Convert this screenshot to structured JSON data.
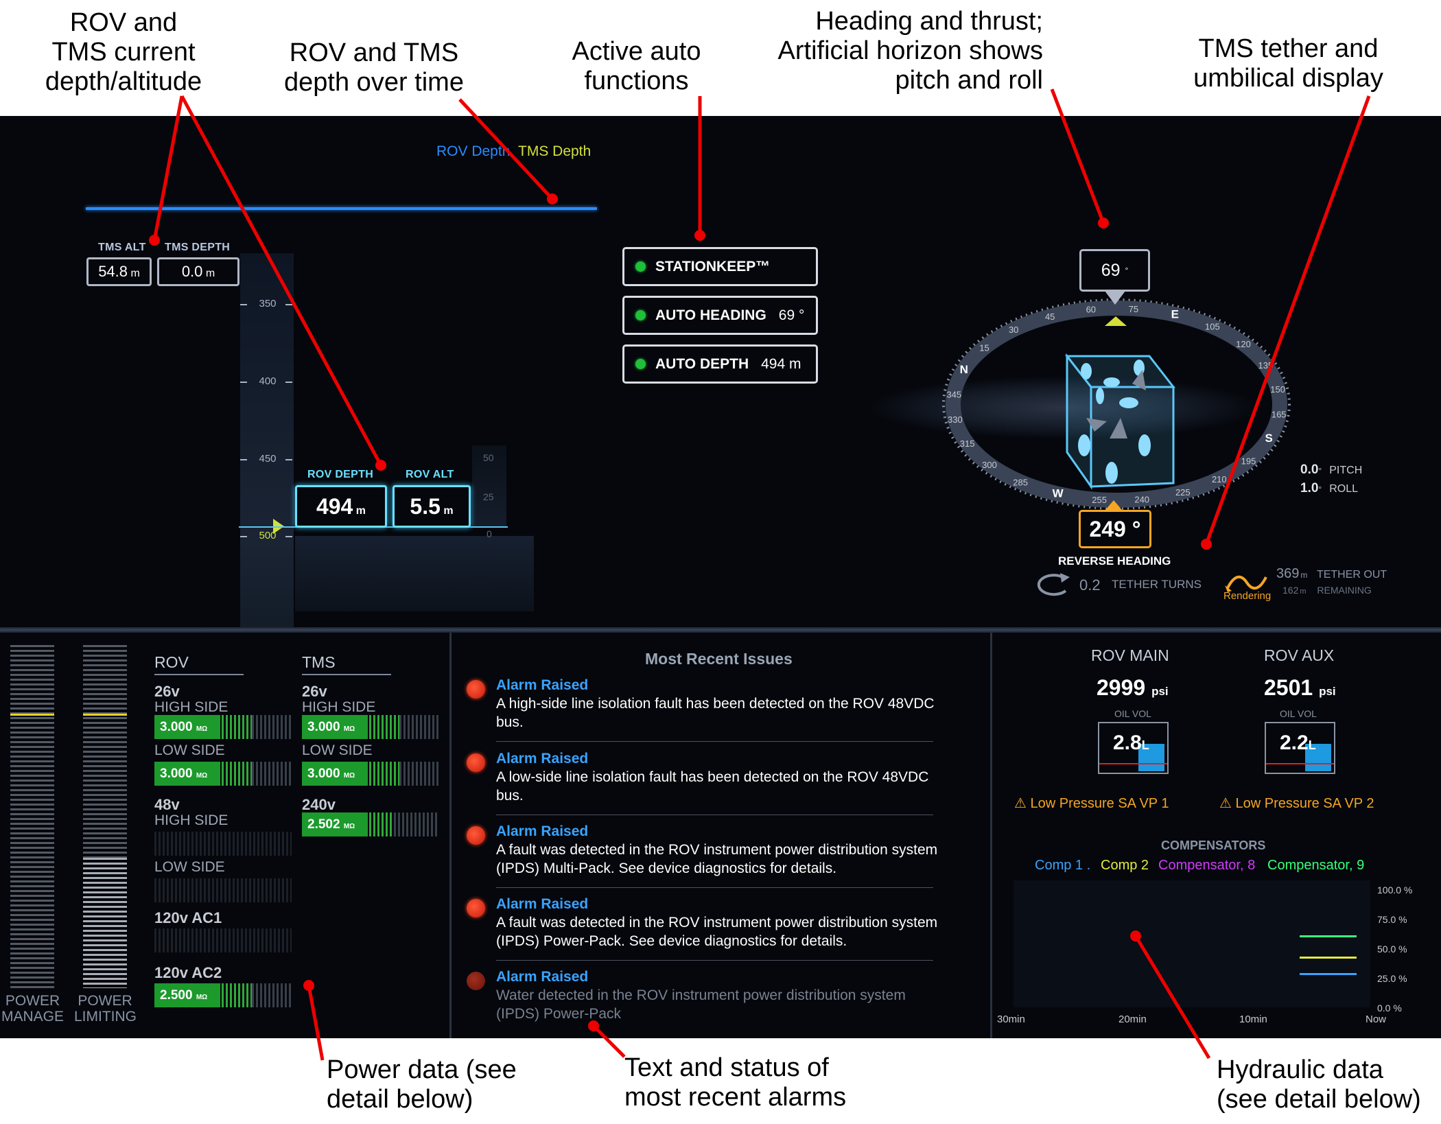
{
  "callouts": {
    "current_depth": "ROV and\nTMS current\ndepth/altitude",
    "depth_over_time": "ROV and TMS\ndepth over time",
    "auto_functions": "Active auto\nfunctions",
    "heading": "Heading and thrust;\nArtificial horizon shows\npitch and roll",
    "tether": "TMS tether and\numbilical display",
    "power": "Power data (see\ndetail below)",
    "alarms": "Text and status of\nmost recent alarms",
    "hydraulic": "Hydraulic data\n(see detail below)"
  },
  "depth_chart": {
    "legend_rov": "ROV Depth",
    "legend_tms": "TMS Depth",
    "rov_color": "#2a8cff",
    "tms_color": "#d4e03a",
    "tms_alt_label": "TMS ALT",
    "tms_alt_value": "54.8",
    "tms_alt_unit": "m",
    "tms_depth_label": "TMS DEPTH",
    "tms_depth_value": "0.0",
    "tms_depth_unit": "m",
    "rov_depth_label": "ROV DEPTH",
    "rov_depth_value": "494",
    "rov_depth_unit": "m",
    "rov_alt_label": "ROV ALT",
    "rov_alt_value": "5.5",
    "rov_alt_unit": "m",
    "scale_ticks": [
      "350",
      "400",
      "450",
      "500"
    ],
    "alt_ticks": [
      "50",
      "25",
      "0"
    ]
  },
  "auto_functions": [
    {
      "label": "STATIONKEEP™",
      "value": ""
    },
    {
      "label": "AUTO HEADING",
      "value": "69 °"
    },
    {
      "label": "AUTO DEPTH",
      "value": "494 m"
    }
  ],
  "heading": {
    "current": "69",
    "current_unit": "°",
    "reverse": "249 °",
    "reverse_label": "REVERSE HEADING",
    "pitch_value": "0.0",
    "pitch_unit": "°",
    "pitch_label": "PITCH",
    "roll_value": "1.0",
    "roll_unit": "°",
    "roll_label": "ROLL",
    "compass_labels": [
      "15",
      "30",
      "45",
      "60",
      "75",
      "E",
      "105",
      "120",
      "135",
      "150",
      "165",
      "S",
      "195",
      "210",
      "225",
      "240",
      "255",
      "W",
      "285",
      "300",
      "315",
      "330",
      "345",
      "N"
    ]
  },
  "tether": {
    "turns_value": "0.2",
    "turns_label": "TETHER TURNS",
    "out_value": "369",
    "out_unit": "m",
    "out_label": "TETHER OUT",
    "remaining_value": "162",
    "remaining_unit": "m",
    "remaining_label": "REMAINING",
    "rendering": "Rendering"
  },
  "power": {
    "bar_labels": [
      "POWER\nMANAGE",
      "POWER\nLIMITING"
    ],
    "bar_fill_fraction": [
      0,
      0.38
    ],
    "rov_head": "ROV",
    "tms_head": "TMS",
    "rov": {
      "v26": "26v",
      "high_side": "HIGH SIDE",
      "low_side": "LOW SIDE",
      "v26_high": "3.000",
      "v26_low": "3.000",
      "v48": "48v",
      "v48_high_side": "HIGH SIDE",
      "v48_low_side": "LOW SIDE",
      "ac1": "120v AC1",
      "ac2": "120v AC2",
      "ac2_value": "2.500"
    },
    "tms": {
      "v26": "26v",
      "high_side": "HIGH SIDE",
      "low_side": "LOW SIDE",
      "v26_high": "3.000",
      "v26_low": "3.000",
      "v240": "240v",
      "v240_value": "2.502"
    },
    "unit": "MΩ"
  },
  "issues": {
    "title": "Most Recent Issues",
    "items": [
      {
        "title": "Alarm Raised",
        "msg": "A high-side line isolation fault has been detected on the ROV 48VDC bus."
      },
      {
        "title": "Alarm Raised",
        "msg": "A low-side line isolation fault has been detected on the ROV 48VDC bus."
      },
      {
        "title": "Alarm Raised",
        "msg": "A fault was detected in the ROV instrument power distribution system (IPDS) Multi-Pack.  See device diagnostics for details."
      },
      {
        "title": "Alarm Raised",
        "msg": "A fault was detected in the ROV instrument power distribution system (IPDS) Power-Pack.  See device diagnostics for details."
      },
      {
        "title": "Alarm Raised",
        "msg": "Water detected in the ROV instrument power distribution system (IPDS) Power-Pack"
      }
    ]
  },
  "hydraulics": {
    "main_label": "ROV MAIN",
    "main_psi": "2999",
    "aux_label": "ROV AUX",
    "aux_psi": "2501",
    "psi_unit": "psi",
    "oil_label": "OIL VOL",
    "main_oil": "2.8",
    "aux_oil": "2.2",
    "oil_unit": "L",
    "warn_1": "⚠ Low Pressure SA VP 1",
    "warn_2": "⚠ Low Pressure SA VP 2",
    "comp_head": "COMPENSATORS",
    "comp_legend": [
      {
        "name": "Comp 1 .",
        "color": "#3aa3ff"
      },
      {
        "name": "Comp 2",
        "color": "#e4ec3a"
      },
      {
        "name": "Compensator, 8",
        "color": "#d23aff"
      },
      {
        "name": "Compensator, 9",
        "color": "#3aff7a"
      }
    ],
    "pct_ticks": [
      "100.0 %",
      "75.0 %",
      "50.0 %",
      "25.0 %",
      "0.0 %"
    ],
    "time_ticks": [
      "30min",
      "20min",
      "10min",
      "Now"
    ]
  },
  "chart_data": {
    "type": "line",
    "x": [
      "30min",
      "20min",
      "10min",
      "Now"
    ],
    "ylim": [
      0,
      100
    ],
    "series": [
      {
        "name": "Comp 1 .",
        "values": [
          null,
          null,
          27,
          27
        ]
      },
      {
        "name": "Comp 2",
        "values": [
          null,
          null,
          40,
          40
        ]
      },
      {
        "name": "Compensator, 9",
        "values": [
          null,
          null,
          57,
          57
        ]
      }
    ]
  }
}
